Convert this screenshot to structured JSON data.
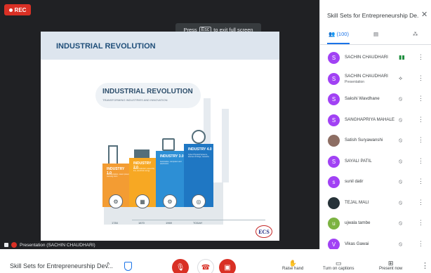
{
  "recording": {
    "label": "REC"
  },
  "fullscreen_hint": {
    "prefix": "Press",
    "key": "Esc",
    "suffix": "to exit full screen"
  },
  "slide": {
    "header_title": "INDUSTRIAL REVOLUTION",
    "cloud_title": "INDUSTRIAL REVOLUTION",
    "cloud_subtitle": "TRANSFORMING INDUSTRIES AND INNOVATION",
    "steps": [
      {
        "label": "INDUSTRY 1.0",
        "color": "#f39c33",
        "desc": "Mechanization, steam power, weaving loom",
        "icon": "⚙",
        "year": "1784"
      },
      {
        "label": "INDUSTRY 2.0",
        "color": "#f7a823",
        "desc": "Mass production, assembly line, electrical energy",
        "icon": "▦",
        "year": "1870"
      },
      {
        "label": "INDUSTRY 3.0",
        "color": "#2d8fd5",
        "desc": "Automation, computers and electronics",
        "icon": "⚙",
        "year": "1969"
      },
      {
        "label": "INDUSTRY 4.0",
        "color": "#1f77c3",
        "desc": "Cyber Physical Systems, internet of things, networks",
        "icon": "◎",
        "year": "TODAY"
      }
    ],
    "logo": "ECS"
  },
  "presenter_bar": {
    "label": "Presentation (SACHIN CHAUDHARI)"
  },
  "meeting": {
    "name": "Skill Sets for Entrepreneurship Dev..."
  },
  "controls": {
    "raise_hand": "Raise hand",
    "captions": "Turn on captions",
    "present": "Present now"
  },
  "sidebar": {
    "title": "Skill Sets for Entrepreneurship De...",
    "people_count": "(100)",
    "participants": [
      {
        "name": "SACHIN CHAUDHARI",
        "sub": "",
        "initial": "S",
        "color": "#a142f4",
        "mic": "speaking"
      },
      {
        "name": "SACHIN CHAUDHARI",
        "sub": "Presentation",
        "initial": "S",
        "color": "#a142f4",
        "mic": "presenting"
      },
      {
        "name": "Sakshi Wavdhane",
        "sub": "",
        "initial": "S",
        "color": "#a142f4",
        "mic": "muted"
      },
      {
        "name": "SANGHAPRIYA MAHALE",
        "sub": "",
        "initial": "S",
        "color": "#a142f4",
        "mic": "muted"
      },
      {
        "name": "Satish Suryawanshi",
        "sub": "",
        "initial": "",
        "color": "#8d6e63",
        "mic": "muted"
      },
      {
        "name": "SAYALI PATIL",
        "sub": "",
        "initial": "S",
        "color": "#a142f4",
        "mic": "muted"
      },
      {
        "name": "sunil datir",
        "sub": "",
        "initial": "s",
        "color": "#a142f4",
        "mic": "muted"
      },
      {
        "name": "TEJAL MALI",
        "sub": "",
        "initial": "",
        "color": "#263238",
        "mic": "muted"
      },
      {
        "name": "ujwala tambe",
        "sub": "",
        "initial": "u",
        "color": "#7cb342",
        "mic": "muted"
      },
      {
        "name": "Vikas Gawai",
        "sub": "",
        "initial": "V",
        "color": "#a142f4",
        "mic": "muted"
      }
    ]
  }
}
